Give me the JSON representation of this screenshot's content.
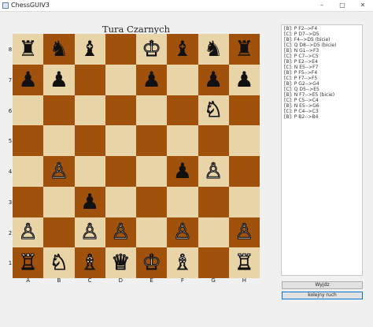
{
  "window": {
    "title": "ChessGUIV3",
    "controls": [
      "–",
      "□",
      "✕"
    ]
  },
  "status": "Tura Czarnych",
  "board": {
    "files": [
      "A",
      "B",
      "C",
      "D",
      "E",
      "F",
      "G",
      "H"
    ],
    "ranks": [
      "8",
      "7",
      "6",
      "5",
      "4",
      "3",
      "2",
      "1"
    ],
    "rows": [
      [
        "bR",
        "bN",
        "bB",
        "",
        "wK",
        "bB",
        "bN",
        "bR"
      ],
      [
        "bP",
        "bP",
        "",
        "",
        "bP",
        "",
        "bP",
        "bP"
      ],
      [
        "",
        "",
        "",
        "",
        "",
        "",
        "wN",
        ""
      ],
      [
        "",
        "",
        "",
        "",
        "",
        "",
        "",
        ""
      ],
      [
        "",
        "wP",
        "",
        "",
        "",
        "bP",
        "wP",
        ""
      ],
      [
        "",
        "",
        "bP",
        "",
        "",
        "",
        "",
        ""
      ],
      [
        "wP",
        "",
        "wP",
        "wP",
        "",
        "wP",
        "",
        "wP"
      ],
      [
        "wR",
        "wN",
        "wB",
        "wQ",
        "wK",
        "wB",
        "",
        "wR"
      ]
    ],
    "light_color": "#e8d4a6",
    "dark_color": "#a0510c"
  },
  "pieces": {
    "wK": "♔",
    "wQ": "♕",
    "wR": "♖",
    "wB": "♗",
    "wN": "♘",
    "wP": "♙",
    "bK": "♚",
    "bQ": "♛",
    "bR": "♜",
    "bB": "♝",
    "bN": "♞",
    "bP": "♟"
  },
  "move_log": [
    "[B]: P F2-->F4",
    "[C]: P D7-->D5",
    "[B]: F4-->D5 (bicie)",
    "[C]: Q D8-->D5 (bicie)",
    "[B]: N G1-->F3",
    "[C]: P C7-->C5",
    "[B]: P E2-->E4",
    "[C]: N E5-->F7",
    "[B]: P F5-->F4",
    "[C]: P F7-->F5",
    "[B]: P G2-->G4",
    "[C]: Q D5-->E5",
    "[B]: N F7-->E5 (bicie)",
    "[C]: P C5-->C4",
    "[B]: N E5-->G6",
    "[C]: P C4-->C3",
    "[B]: P B2-->B4"
  ],
  "buttons": {
    "exit": "Wyjdz",
    "next_move": "kolejny ruch"
  }
}
